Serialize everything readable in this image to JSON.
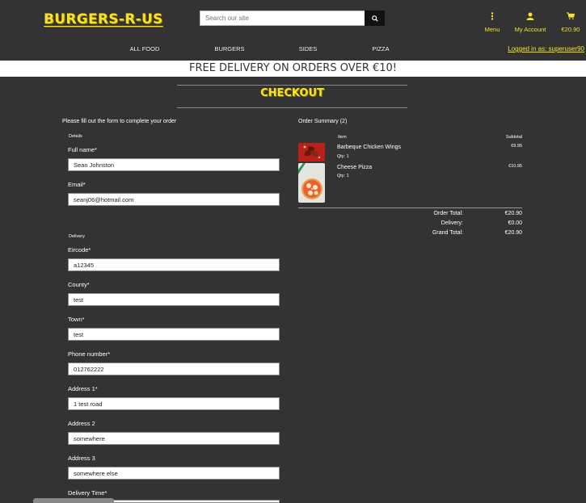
{
  "header": {
    "logo": "BURGERS-R-US",
    "search_placeholder": "Search our site",
    "menu_label": "Menu",
    "account_label": "My Account",
    "cart_total": "€20.90"
  },
  "nav": {
    "items": [
      "ALL FOOD",
      "BURGERS",
      "SIDES",
      "PIZZA"
    ],
    "logged_in": "Logged in as: superuser90"
  },
  "banner": "FREE DELIVERY ON ORDERS OVER €10!",
  "checkout": {
    "title": "CHECKOUT",
    "intro": "Please fill out the form to complete your order",
    "details_label": "Details",
    "delivery_label": "Delivery",
    "fields": {
      "full_name": {
        "label": "Full name*",
        "value": "Sean Johnston"
      },
      "email": {
        "label": "Email*",
        "value": "seanj06@hotmail.com"
      },
      "eircode": {
        "label": "Eircode*",
        "value": "a12345"
      },
      "county": {
        "label": "County*",
        "value": "test"
      },
      "town": {
        "label": "Town*",
        "value": "test"
      },
      "phone": {
        "label": "Phone number*",
        "value": "012762222"
      },
      "address1": {
        "label": "Address 1*",
        "value": "1 test road"
      },
      "address2": {
        "label": "Address 2",
        "value": "somewhere"
      },
      "address3": {
        "label": "Address 3",
        "value": "somewhere else"
      },
      "delivery_time": {
        "label": "Delivery Time*",
        "value": ""
      }
    }
  },
  "summary": {
    "title": "Order Summary (2)",
    "col_item": "Item",
    "col_subtotal": "Subtotal",
    "items": [
      {
        "name": "Barbeque Chicken Wings",
        "qty": "Qty: 1",
        "price": "€9.95"
      },
      {
        "name": "Cheese Pizza",
        "qty": "Qty: 1",
        "price": "€10.95"
      }
    ],
    "order_total_label": "Order Total:",
    "order_total": "€20.90",
    "delivery_label": "Delivery:",
    "delivery": "€0.00",
    "grand_total_label": "Grand Total:",
    "grand_total": "€20.90"
  }
}
